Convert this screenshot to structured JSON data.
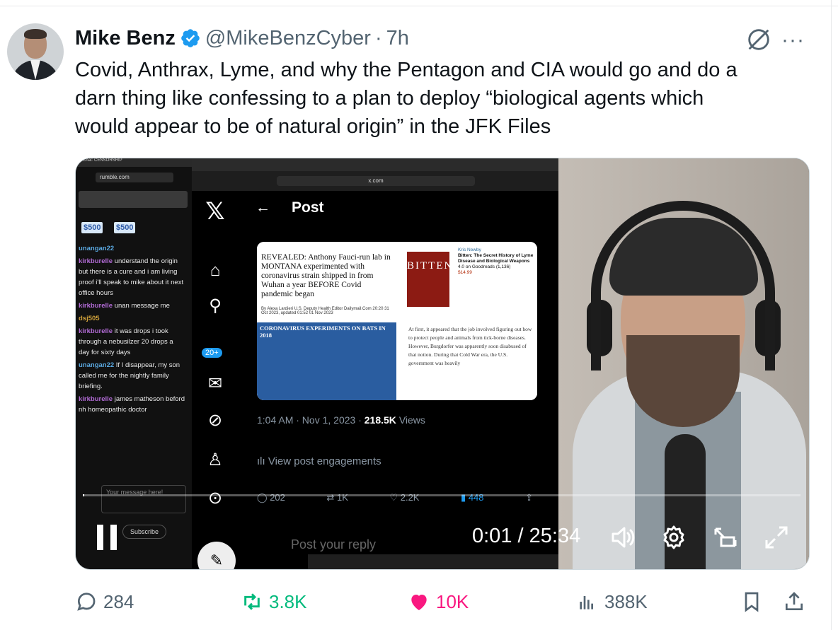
{
  "tweet": {
    "author_name": "Mike Benz",
    "handle": "@MikeBenzCyber",
    "separator": "·",
    "time": "7h",
    "text_lines": [
      "Covid, Anthrax, Lyme, and why the Pentagon and CIA would go and do a",
      "darn thing like confessing to a plan to deploy “biological agents which",
      "would appear to be of natural origin” in the JFK Files"
    ],
    "more_label": "···"
  },
  "video": {
    "time_current": "0:01",
    "time_sep": " / ",
    "time_total": "25:34",
    "progress_fraction": 0.0007,
    "embedded": {
      "chat": {
        "window_title": "Chat: CENSORSHIP",
        "url": "rumble.com",
        "badges": [
          "$500",
          "$500"
        ],
        "messages": [
          {
            "user": "unangan22",
            "text": ""
          },
          {
            "user": "kirkburelle",
            "text": "understand the origin but there is a cure and i am living proof i'll speak to mike about it next office hours"
          },
          {
            "user": "kirkburelle",
            "text": "unan message me"
          },
          {
            "user": "dsj505",
            "text": ""
          },
          {
            "user": "kirkburelle",
            "text": "it was drops i took through a nebusilzer 20 drops a day for sixty days"
          },
          {
            "user": "unangan22",
            "text": "If I disappear, my son called me for the nightly family briefing."
          },
          {
            "user": "kirkburelle",
            "text": "james matheson beford nh homeopathic doctor"
          }
        ],
        "input_placeholder": "Your message here!",
        "subscribe_label": "Subscribe"
      },
      "browser": {
        "url": "x.com",
        "page_title": "Post",
        "notifications_badge": "20+",
        "article_headline": "REVEALED: Anthony Fauci-run lab in MONTANA experimented with coronavirus strain shipped in from Wuhan a year BEFORE Covid pandemic began",
        "article_byline": "By Alexa Lardieri U.S. Deputy Health Editor Dailymail.Com 20:20 31 Oct 2023, updated 01:52 01 Nov 2023",
        "article_band_title": "CORONAVIRUS EXPERIMENTS ON BATS IN 2018",
        "book_title": "BITTEN",
        "book_author": "Kris Newby",
        "book_full_title": "Bitten: The Secret History of Lyme Disease and Biological Weapons",
        "book_rating": "4.0 on Goodreads (1,136)",
        "book_price": "$14.99",
        "excerpt": "At first, it appeared that the job involved figuring out how to protect people and animals from tick-borne diseases. However, Burgdorfer was apparently soon disabused of that notion. During that Cold War era, the U.S. government was heavily",
        "post_time": "1:04 AM · Nov 1, 2023",
        "post_views_count": "218.5K",
        "post_views_label": "Views",
        "engagements_label": "View post engagements",
        "replies": "202",
        "reposts": "1K",
        "likes": "2.2K",
        "bookmarks": "448",
        "reply_placeholder": "Post your reply",
        "status_url": "x.com/MikeBenzCyber/status/1719858127095814377"
      }
    }
  },
  "stats": {
    "replies": "284",
    "reposts": "3.8K",
    "likes": "10K",
    "views": "388K"
  },
  "colors": {
    "accent": "#1d9bf0",
    "repost": "#00ba7c",
    "like": "#f91880",
    "muted": "#536471"
  }
}
